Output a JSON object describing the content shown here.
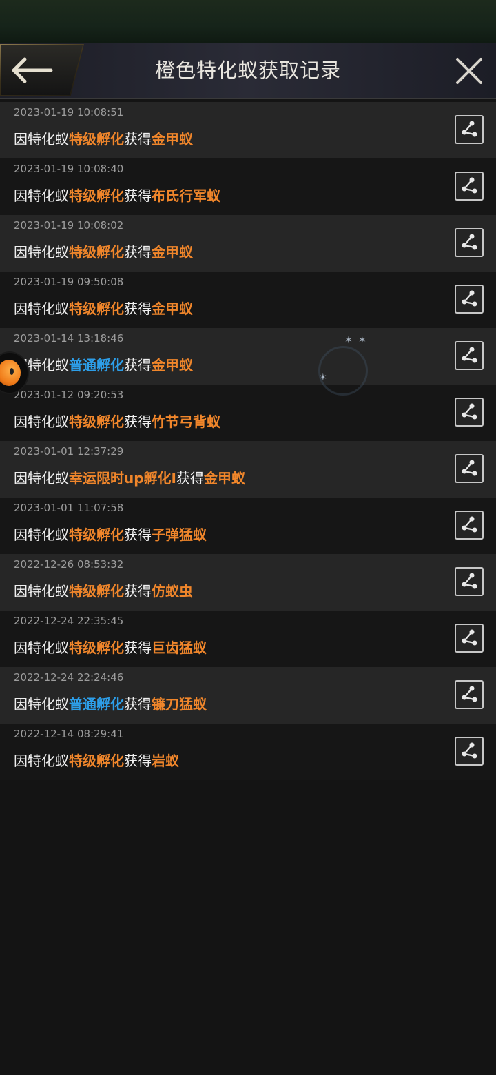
{
  "header": {
    "title": "橙色特化蚁获取记录"
  },
  "colors": {
    "orange": "#f0862b",
    "blue": "#2d9ee8",
    "text": "#f0f0f0",
    "time": "#9d9d9d"
  },
  "records": [
    {
      "time": "2023-01-19 10:08:51",
      "prefix": "因特化蚁",
      "method": "特级孵化",
      "method_color": "orange",
      "mid": "获得",
      "item": "金甲蚁"
    },
    {
      "time": "2023-01-19 10:08:40",
      "prefix": "因特化蚁",
      "method": "特级孵化",
      "method_color": "orange",
      "mid": "获得",
      "item": "布氏行军蚁"
    },
    {
      "time": "2023-01-19 10:08:02",
      "prefix": "因特化蚁",
      "method": "特级孵化",
      "method_color": "orange",
      "mid": "获得",
      "item": "金甲蚁"
    },
    {
      "time": "2023-01-19 09:50:08",
      "prefix": "因特化蚁",
      "method": "特级孵化",
      "method_color": "orange",
      "mid": "获得",
      "item": "金甲蚁"
    },
    {
      "time": "2023-01-14 13:18:46",
      "prefix": "因特化蚁",
      "method": "普通孵化",
      "method_color": "blue",
      "mid": "获得",
      "item": "金甲蚁"
    },
    {
      "time": "2023-01-12 09:20:53",
      "prefix": "因特化蚁",
      "method": "特级孵化",
      "method_color": "orange",
      "mid": "获得",
      "item": "竹节弓背蚁"
    },
    {
      "time": "2023-01-01 12:37:29",
      "prefix": "因特化蚁",
      "method": "幸运限时up孵化I",
      "method_color": "orange",
      "mid": "获得",
      "item": "金甲蚁"
    },
    {
      "time": "2023-01-01 11:07:58",
      "prefix": "因特化蚁",
      "method": "特级孵化",
      "method_color": "orange",
      "mid": "获得",
      "item": "子弹猛蚁"
    },
    {
      "time": "2022-12-26 08:53:32",
      "prefix": "因特化蚁",
      "method": "特级孵化",
      "method_color": "orange",
      "mid": "获得",
      "item": "仿蚁虫"
    },
    {
      "time": "2022-12-24 22:35:45",
      "prefix": "因特化蚁",
      "method": "特级孵化",
      "method_color": "orange",
      "mid": "获得",
      "item": "巨齿猛蚁"
    },
    {
      "time": "2022-12-24 22:24:46",
      "prefix": "因特化蚁",
      "method": "普通孵化",
      "method_color": "blue",
      "mid": "获得",
      "item": "镰刀猛蚁"
    },
    {
      "time": "2022-12-14 08:29:41",
      "prefix": "因特化蚁",
      "method": "特级孵化",
      "method_color": "orange",
      "mid": "获得",
      "item": "岩蚁"
    }
  ],
  "icons": {
    "back": "back-arrow-icon",
    "close": "close-icon",
    "share": "share-icon"
  }
}
